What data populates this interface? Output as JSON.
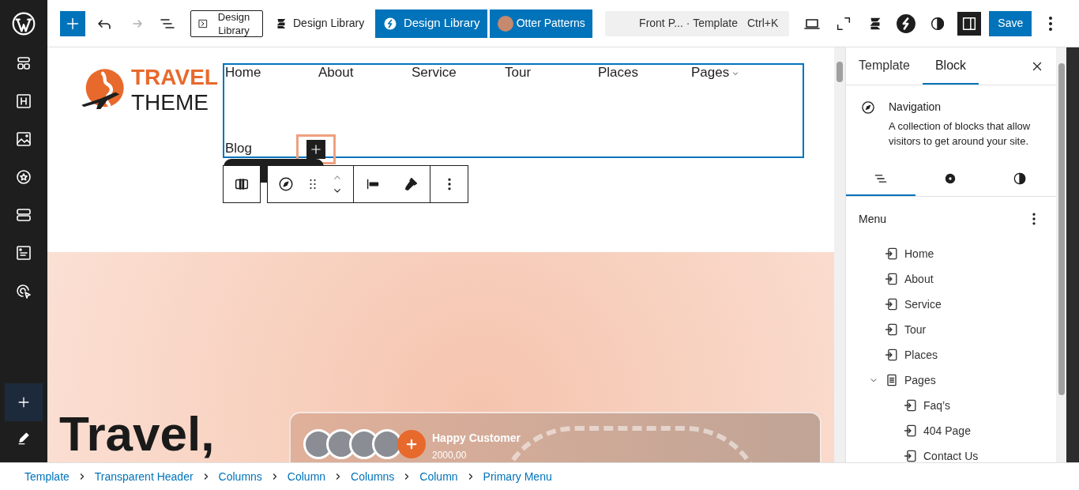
{
  "toolbar": {
    "redo": {
      "disabled": true
    },
    "library_buttons": [
      {
        "kind": "boxed",
        "label": "Design Library"
      },
      {
        "kind": "plain",
        "label": "Design Library"
      },
      {
        "kind": "primary",
        "label": "Design Library"
      },
      {
        "kind": "otter",
        "label": "Otter Patterns"
      }
    ],
    "command_bar": {
      "title": "Front P...",
      "type": "· Template",
      "shortcut": "Ctrl+K"
    },
    "settings_open": true,
    "save": "Save"
  },
  "canvas": {
    "logo": {
      "line1": "TRAVEL",
      "line2": "THEME"
    },
    "nav": [
      {
        "label": "Home",
        "has_submenu": false
      },
      {
        "label": "About",
        "has_submenu": false
      },
      {
        "label": "Service",
        "has_submenu": false
      },
      {
        "label": "Tour",
        "has_submenu": false
      },
      {
        "label": "Places",
        "has_submenu": false
      },
      {
        "label": "Pages",
        "has_submenu": true
      },
      {
        "label": "Blog",
        "has_submenu": false
      }
    ],
    "hero": {
      "heading": "Travel,",
      "card": {
        "title": "Happy Customer",
        "value": "2000,00"
      }
    }
  },
  "panel": {
    "tabs": [
      {
        "label": "Template",
        "selected": false
      },
      {
        "label": "Block",
        "selected": true
      }
    ],
    "block": {
      "title": "Navigation",
      "description": "A collection of blocks that allow visitors to get around your site."
    },
    "subtabs": [
      {
        "kind": "list",
        "selected": true
      },
      {
        "kind": "settings",
        "selected": false
      },
      {
        "kind": "styles",
        "selected": false
      }
    ],
    "menu": {
      "label": "Menu",
      "items": [
        {
          "label": "Home",
          "kind": "link"
        },
        {
          "label": "About",
          "kind": "link"
        },
        {
          "label": "Service",
          "kind": "link"
        },
        {
          "label": "Tour",
          "kind": "link"
        },
        {
          "label": "Places",
          "kind": "link"
        },
        {
          "label": "Pages",
          "kind": "page",
          "expanded": true,
          "children": [
            {
              "label": "Faq’s",
              "kind": "link"
            },
            {
              "label": "404 Page",
              "kind": "link"
            },
            {
              "label": "Contact Us",
              "kind": "link"
            }
          ]
        }
      ]
    }
  },
  "breadcrumb": [
    "Template",
    "Transparent Header",
    "Columns",
    "Column",
    "Columns",
    "Column",
    "Primary Menu"
  ]
}
